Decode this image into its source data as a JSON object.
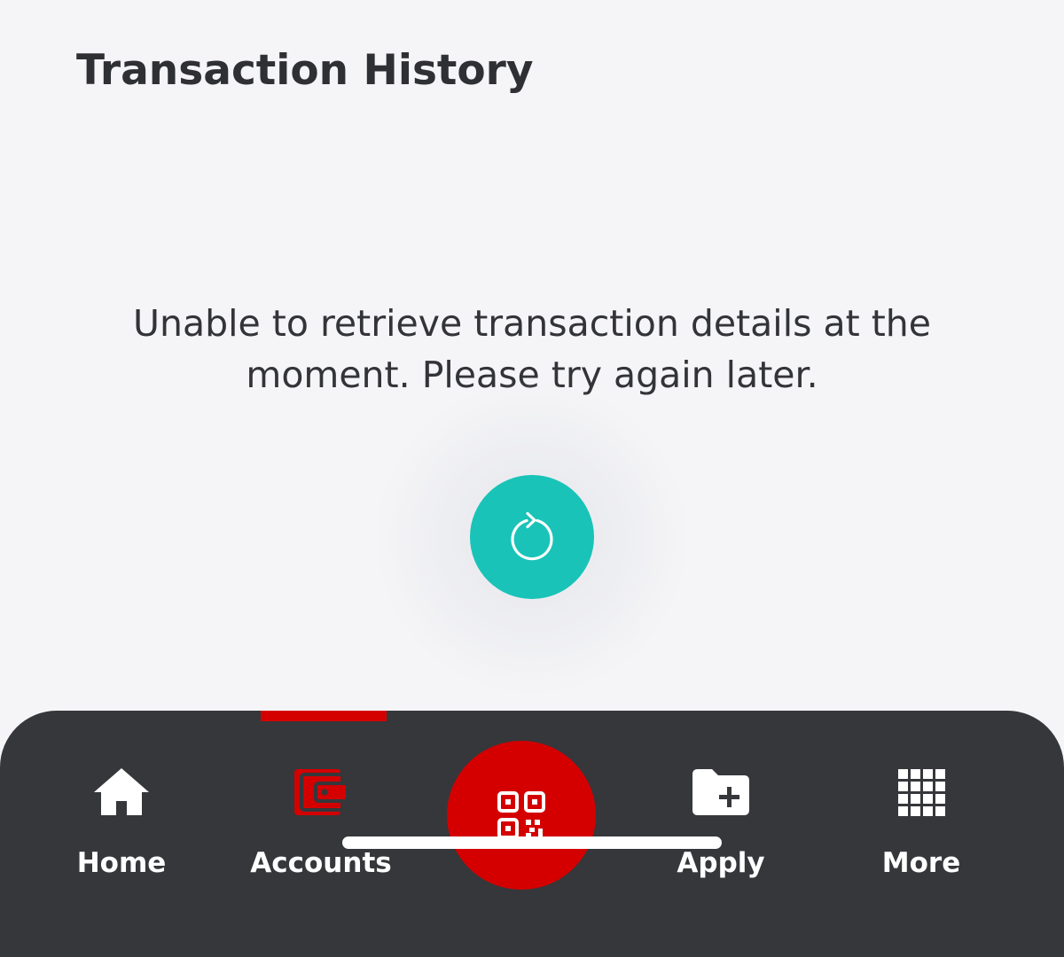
{
  "page": {
    "title": "Transaction History",
    "error_message": "Unable to retrieve transaction details at the moment. Please try again later.",
    "retry_icon": "refresh-icon"
  },
  "colors": {
    "background": "#f5f5f7",
    "retry_button": "#19c3b8",
    "nav_background": "#35373b",
    "accent_red": "#d40000",
    "text_dark": "#2f3033"
  },
  "bottom_nav": {
    "active_tab": "Accounts",
    "items": [
      {
        "label": "Home",
        "icon": "home-icon"
      },
      {
        "label": "Accounts",
        "icon": "wallet-icon"
      },
      {
        "label": "",
        "icon": "qr-code-icon"
      },
      {
        "label": "Apply",
        "icon": "folder-plus-icon"
      },
      {
        "label": "More",
        "icon": "grid-icon"
      }
    ]
  }
}
